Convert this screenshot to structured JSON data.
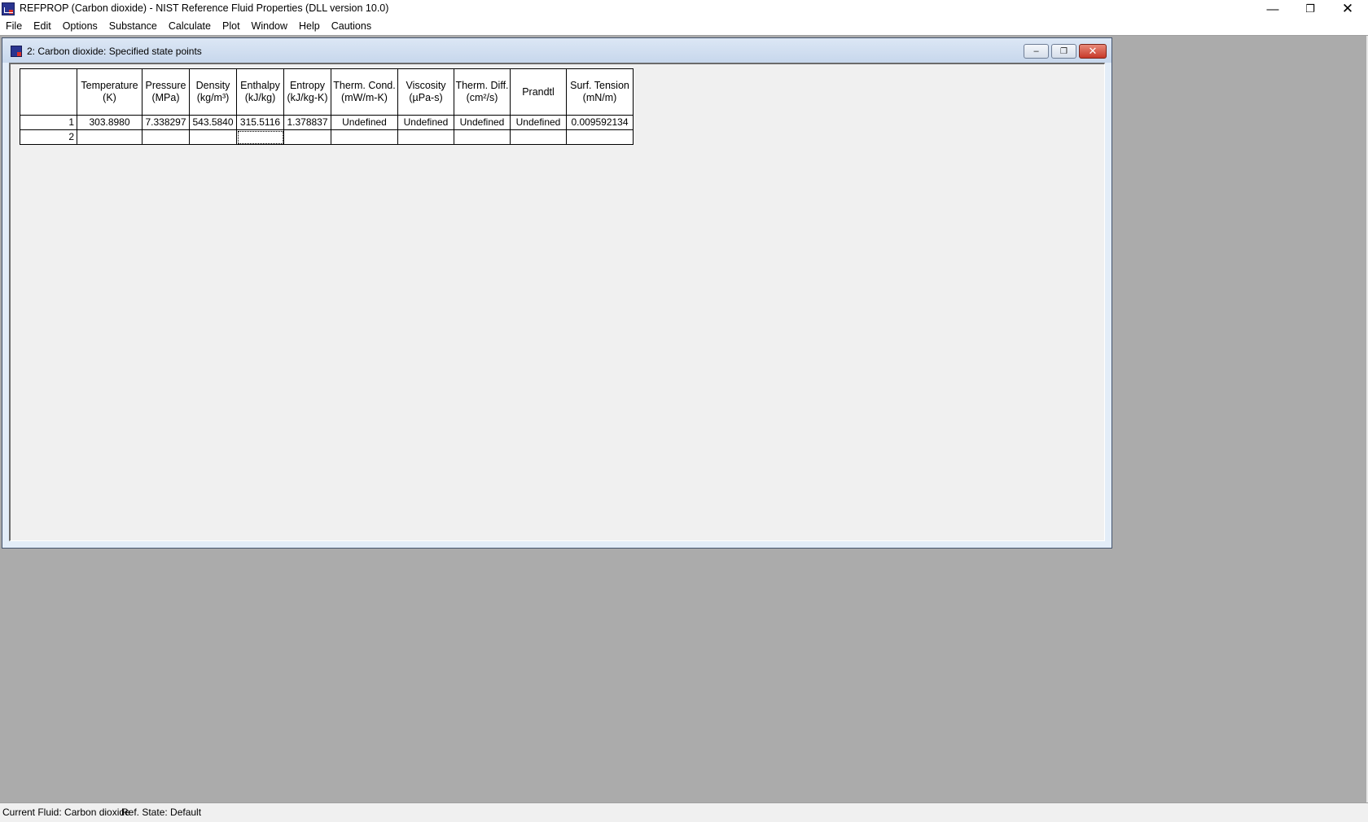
{
  "app": {
    "title": "REFPROP (Carbon dioxide) - NIST Reference Fluid Properties (DLL version 10.0)",
    "controls": {
      "minimize": "—",
      "maximize": "❐",
      "close": "✕"
    }
  },
  "menu": [
    "File",
    "Edit",
    "Options",
    "Substance",
    "Calculate",
    "Plot",
    "Window",
    "Help",
    "Cautions"
  ],
  "child_window": {
    "title": "2: Carbon dioxide: Specified state points",
    "controls": {
      "minimize": "‒",
      "restore": "❐",
      "close": "✕"
    }
  },
  "table": {
    "columns": [
      {
        "name": "Temperature",
        "unit": "(K)"
      },
      {
        "name": "Pressure",
        "unit": "(MPa)"
      },
      {
        "name": "Density",
        "unit": "(kg/m³)"
      },
      {
        "name": "Enthalpy",
        "unit": "(kJ/kg)"
      },
      {
        "name": "Entropy",
        "unit": "(kJ/kg-K)"
      },
      {
        "name": "Therm. Cond.",
        "unit": "(mW/m-K)"
      },
      {
        "name": "Viscosity",
        "unit": "(µPa-s)"
      },
      {
        "name": "Therm. Diff.",
        "unit": "(cm²/s)"
      },
      {
        "name": "Prandtl",
        "unit": ""
      },
      {
        "name": "Surf. Tension",
        "unit": "(mN/m)"
      }
    ],
    "rows": [
      {
        "num": "1",
        "cells": [
          "303.8980",
          "7.338297",
          "543.5840",
          "315.5116",
          "1.378837",
          "Undefined",
          "Undefined",
          "Undefined",
          "Undefined",
          "0.009592134"
        ]
      },
      {
        "num": "2",
        "cells": [
          "",
          "",
          "",
          "",
          "",
          "",
          "",
          "",
          "",
          ""
        ]
      }
    ]
  },
  "status": {
    "fluid": "Current Fluid: Carbon dioxide",
    "ref_state": "Ref. State: Default"
  },
  "colors": {
    "mdi_background": "#ababab",
    "close_button": "#c7392a",
    "app_icon": "#2a3590"
  }
}
